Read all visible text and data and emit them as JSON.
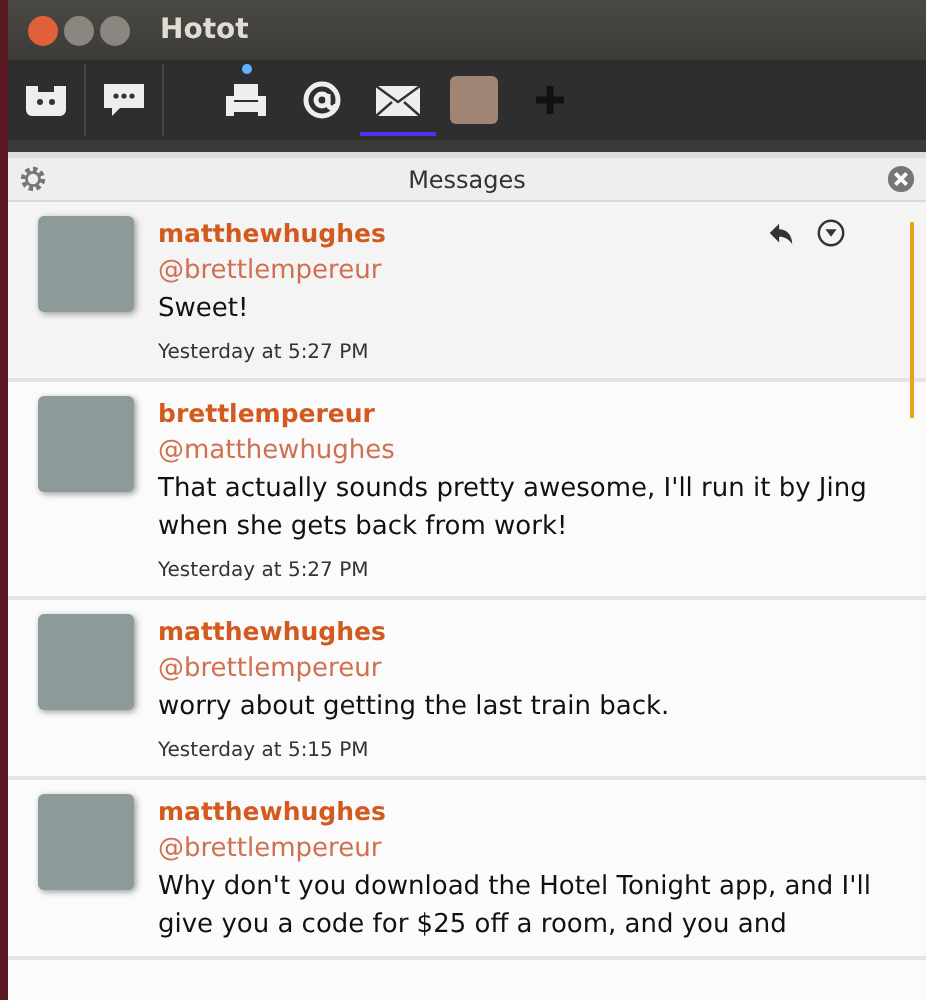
{
  "window": {
    "title": "Hotot"
  },
  "toolbar": [
    {
      "kind": "logo",
      "selected": false,
      "unread": false
    },
    {
      "kind": "compose",
      "selected": false,
      "unread": false
    },
    {
      "kind": "home",
      "selected": false,
      "unread": true
    },
    {
      "kind": "mentions",
      "selected": false,
      "unread": false
    },
    {
      "kind": "messages",
      "selected": true,
      "unread": false
    },
    {
      "kind": "profile",
      "selected": false,
      "unread": false
    },
    {
      "kind": "add",
      "selected": false,
      "unread": false
    }
  ],
  "panel": {
    "title": "Messages"
  },
  "messages": [
    {
      "name": "matthewhughes",
      "mention": "@brettlempereur",
      "text": "Sweet!",
      "time": "Yesterday at 5:27 PM",
      "hovered": true
    },
    {
      "name": "brettlempereur",
      "mention": "@matthewhughes",
      "text": "That actually sounds pretty awesome, I'll run it by Jing when she gets back from work!",
      "time": "Yesterday at 5:27 PM",
      "hovered": false
    },
    {
      "name": "matthewhughes",
      "mention": "@brettlempereur",
      "text": "worry about getting the last train back.",
      "time": "Yesterday at 5:15 PM",
      "hovered": false
    },
    {
      "name": "matthewhughes",
      "mention": "@brettlempereur",
      "text": "Why don't you download the Hotel Tonight app, and I'll give you a code for $25 off a room, and you and",
      "hovered": false
    }
  ]
}
